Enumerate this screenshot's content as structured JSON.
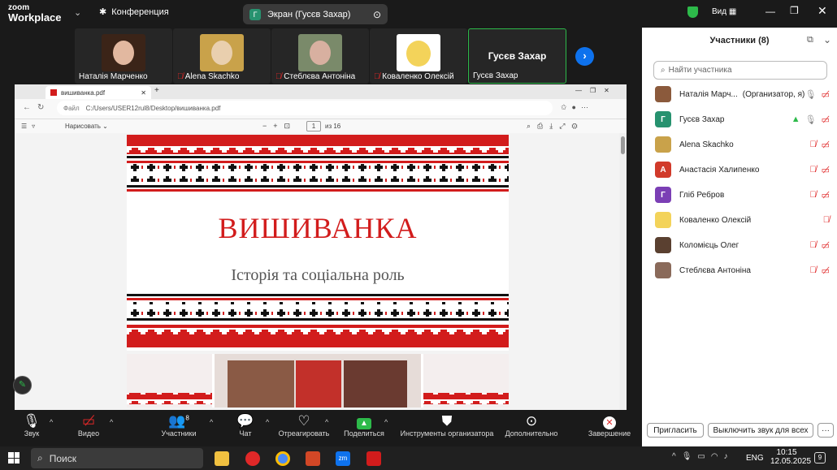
{
  "topbar": {
    "logo_top": "zoom",
    "logo_bottom": "Workplace",
    "meeting_label": "Конференция",
    "share_label": "Экран (Гусєв Захар)",
    "share_badge": "Г",
    "view_label": "Вид"
  },
  "thumbs": [
    {
      "name": "Наталія Марченко",
      "muted": false
    },
    {
      "name": "Alena Skachko",
      "muted": true
    },
    {
      "name": "Стеблєва Антоніна",
      "muted": true
    },
    {
      "name": "Коваленко Олексій",
      "muted": true
    },
    {
      "name": "Гусєв Захар",
      "muted": false,
      "big": "Гусєв Захар"
    }
  ],
  "viewer": {
    "tab_title": "вишиванка.pdf",
    "url_prefix": "Файл",
    "url": "C:/Users/USER12rul8/Desktop/вишиванка.pdf",
    "draw_label": "Нарисовать",
    "page_num": "1",
    "page_of": "из 16",
    "slide_title": "ВИШИВАНКА",
    "slide_subtitle": "Історія та соціальна роль"
  },
  "participants": {
    "title": "Участники (8)",
    "search_placeholder": "Найти участника",
    "list": [
      {
        "name": "Наталія Марч...",
        "role": "(Организатор, я)",
        "avatar_letter": "",
        "color": "#8b5a3c"
      },
      {
        "name": "Гусєв Захар",
        "role": "",
        "avatar_letter": "Г",
        "color": "#27926f"
      },
      {
        "name": "Alena Skachko",
        "role": "",
        "avatar_letter": "",
        "color": "#c9a24a"
      },
      {
        "name": "Анастасія Халипенко",
        "role": "",
        "avatar_letter": "А",
        "color": "#d13a2a"
      },
      {
        "name": "Гліб Ребров",
        "role": "",
        "avatar_letter": "Г",
        "color": "#7b3fb5"
      },
      {
        "name": "Коваленко Олексій",
        "role": "",
        "avatar_letter": "",
        "color": "#f3d35a"
      },
      {
        "name": "Коломієць Олег",
        "role": "",
        "avatar_letter": "",
        "color": "#5a4030"
      },
      {
        "name": "Стеблєва Антоніна",
        "role": "",
        "avatar_letter": "",
        "color": "#8a6a5a"
      }
    ],
    "invite": "Пригласить",
    "mute_all": "Выключить звук для всех",
    "more": "···"
  },
  "toolbar": {
    "sound": "Звук",
    "video": "Видео",
    "participants": "Участники",
    "participants_count": "8",
    "chat": "Чат",
    "react": "Отреагировать",
    "share": "Поделиться",
    "host_tools": "Инструменты организатора",
    "more": "Дополнительно",
    "end": "Завершение"
  },
  "taskbar": {
    "search": "Поиск",
    "lang": "ENG",
    "time": "10:15",
    "date": "12.05.2025",
    "notif": "9"
  }
}
